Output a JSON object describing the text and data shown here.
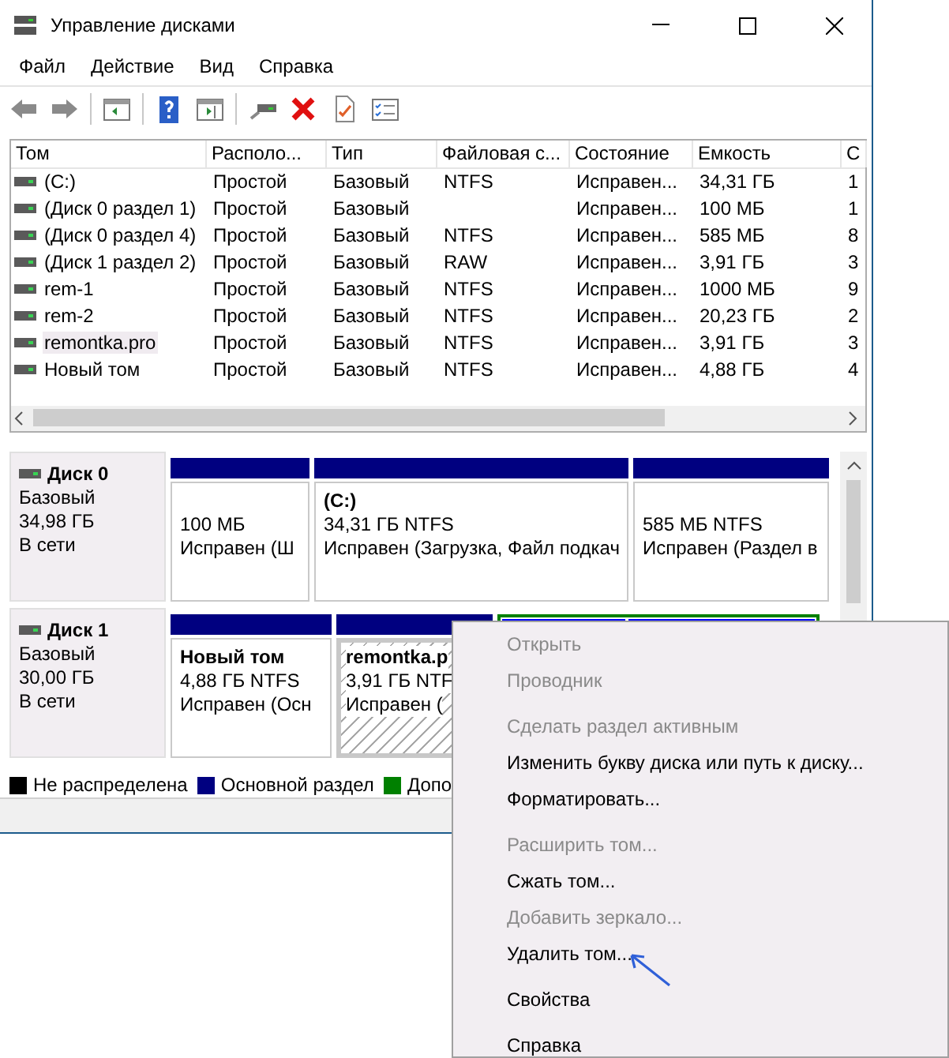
{
  "window": {
    "title": "Управление дисками"
  },
  "menu": [
    {
      "label": "Файл"
    },
    {
      "label": "Действие"
    },
    {
      "label": "Вид"
    },
    {
      "label": "Справка"
    }
  ],
  "table": {
    "columns": [
      "Том",
      "Располо...",
      "Тип",
      "Файловая с...",
      "Состояние",
      "Емкость",
      "С"
    ],
    "rows": [
      {
        "cells": [
          "(C:)",
          "Простой",
          "Базовый",
          "NTFS",
          "Исправен...",
          "34,31 ГБ",
          "1"
        ],
        "selected": false
      },
      {
        "cells": [
          "(Диск 0 раздел 1)",
          "Простой",
          "Базовый",
          "",
          "Исправен...",
          "100 МБ",
          "1"
        ],
        "selected": false
      },
      {
        "cells": [
          "(Диск 0 раздел 4)",
          "Простой",
          "Базовый",
          "NTFS",
          "Исправен...",
          "585 МБ",
          "8"
        ],
        "selected": false
      },
      {
        "cells": [
          "(Диск 1 раздел 2)",
          "Простой",
          "Базовый",
          "RAW",
          "Исправен...",
          "3,91 ГБ",
          "3"
        ],
        "selected": false
      },
      {
        "cells": [
          "rem-1",
          "Простой",
          "Базовый",
          "NTFS",
          "Исправен...",
          "1000 МБ",
          "9"
        ],
        "selected": false
      },
      {
        "cells": [
          "rem-2",
          "Простой",
          "Базовый",
          "NTFS",
          "Исправен...",
          "20,23 ГБ",
          "2"
        ],
        "selected": false
      },
      {
        "cells": [
          "remontka.pro",
          "Простой",
          "Базовый",
          "NTFS",
          "Исправен...",
          "3,91 ГБ",
          "3"
        ],
        "selected": true
      },
      {
        "cells": [
          "Новый том",
          "Простой",
          "Базовый",
          "NTFS",
          "Исправен...",
          "4,88 ГБ",
          "4"
        ],
        "selected": false
      }
    ]
  },
  "disks": [
    {
      "name": "Диск 0",
      "type": "Базовый",
      "size": "34,98 ГБ",
      "status": "В сети",
      "partitions": [
        {
          "kind": "primary",
          "selected": false,
          "lines": [
            "100 МБ",
            "Исправен (Ш"
          ]
        },
        {
          "kind": "primary",
          "selected": false,
          "name": "(C:)",
          "lines": [
            "34,31 ГБ NTFS",
            "Исправен (Загрузка, Файл подкач"
          ]
        },
        {
          "kind": "primary",
          "selected": false,
          "lines": [
            "585 МБ NTFS",
            "Исправен (Раздел в"
          ]
        }
      ]
    },
    {
      "name": "Диск 1",
      "type": "Базовый",
      "size": "30,00 ГБ",
      "status": "В сети",
      "partitions": [
        {
          "kind": "primary",
          "selected": false,
          "name": "Новый том",
          "lines": [
            "4,88 ГБ NTFS",
            "Исправен (Осн"
          ]
        },
        {
          "kind": "primary",
          "selected": true,
          "name": "remontka.p",
          "lines": [
            "3,91 ГБ NTF",
            "Исправен ("
          ]
        },
        {
          "kind": "extended",
          "selected": false,
          "children": [
            {
              "kind": "logical"
            },
            {
              "kind": "logical"
            }
          ]
        }
      ]
    }
  ],
  "legend": [
    {
      "label": "Не распределена",
      "color": "#000000"
    },
    {
      "label": "Основной раздел",
      "color": "#000080"
    },
    {
      "label": "Допо",
      "color": "#008000"
    }
  ],
  "context_menu": [
    {
      "kind": "item",
      "label": "Открыть",
      "disabled": true
    },
    {
      "kind": "item",
      "label": "Проводник",
      "disabled": true
    },
    {
      "kind": "separator"
    },
    {
      "kind": "item",
      "label": "Сделать раздел активным",
      "disabled": true
    },
    {
      "kind": "item",
      "label": "Изменить букву диска или путь к диску...",
      "disabled": false
    },
    {
      "kind": "item",
      "label": "Форматировать...",
      "disabled": false
    },
    {
      "kind": "separator"
    },
    {
      "kind": "item",
      "label": "Расширить том...",
      "disabled": true
    },
    {
      "kind": "item",
      "label": "Сжать том...",
      "disabled": false
    },
    {
      "kind": "item",
      "label": "Добавить зеркало...",
      "disabled": true
    },
    {
      "kind": "item",
      "label": "Удалить том...",
      "disabled": false
    },
    {
      "kind": "separator"
    },
    {
      "kind": "item",
      "label": "Свойства",
      "disabled": false
    },
    {
      "kind": "separator"
    },
    {
      "kind": "item",
      "label": "Справка",
      "disabled": false
    }
  ]
}
